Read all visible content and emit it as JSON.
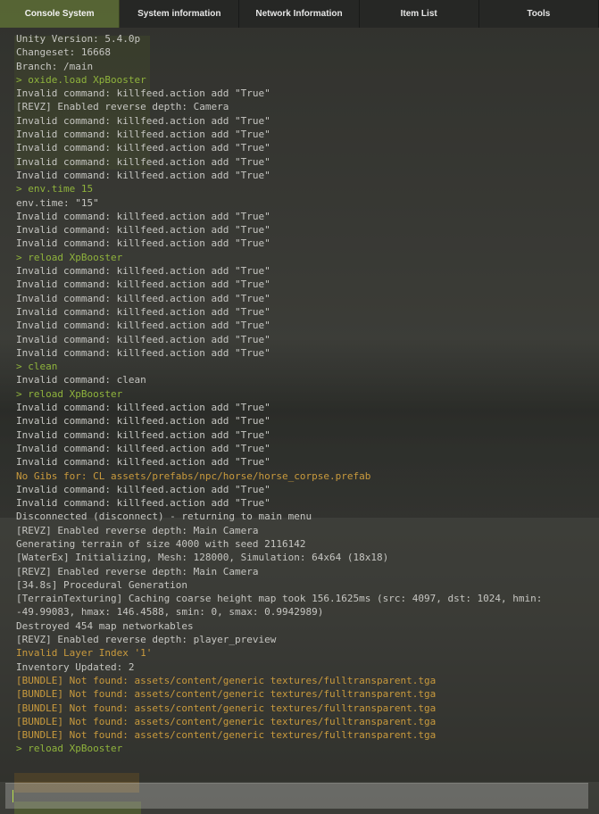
{
  "tabs": [
    {
      "label": "Console System",
      "active": true
    },
    {
      "label": "System information",
      "active": false
    },
    {
      "label": "Network Information",
      "active": false
    },
    {
      "label": "Item List",
      "active": false
    },
    {
      "label": "Tools",
      "active": false
    }
  ],
  "colors": {
    "default_text": "#c6c6c2",
    "command_text": "#8fb33c",
    "warning_text": "#c99a3d",
    "active_tab": "#697c3c"
  },
  "log": [
    {
      "text": "Unity Version: 5.4.0p",
      "type": "default"
    },
    {
      "text": "Changeset: 16668",
      "type": "default"
    },
    {
      "text": "Branch: /main",
      "type": "default"
    },
    {
      "text": "> oxide.load XpBooster",
      "type": "command"
    },
    {
      "text": "Invalid command: killfeed.action add \"True\"",
      "type": "default"
    },
    {
      "text": "[REVZ] Enabled reverse depth: Camera",
      "type": "default"
    },
    {
      "text": "Invalid command: killfeed.action add \"True\"",
      "type": "default"
    },
    {
      "text": "Invalid command: killfeed.action add \"True\"",
      "type": "default"
    },
    {
      "text": "Invalid command: killfeed.action add \"True\"",
      "type": "default"
    },
    {
      "text": "Invalid command: killfeed.action add \"True\"",
      "type": "default"
    },
    {
      "text": "Invalid command: killfeed.action add \"True\"",
      "type": "default"
    },
    {
      "text": "> env.time 15",
      "type": "command"
    },
    {
      "text": "env.time: \"15\"",
      "type": "default"
    },
    {
      "text": "Invalid command: killfeed.action add \"True\"",
      "type": "default"
    },
    {
      "text": "Invalid command: killfeed.action add \"True\"",
      "type": "default"
    },
    {
      "text": "Invalid command: killfeed.action add \"True\"",
      "type": "default"
    },
    {
      "text": "> reload XpBooster",
      "type": "command"
    },
    {
      "text": "Invalid command: killfeed.action add \"True\"",
      "type": "default"
    },
    {
      "text": "Invalid command: killfeed.action add \"True\"",
      "type": "default"
    },
    {
      "text": "Invalid command: killfeed.action add \"True\"",
      "type": "default"
    },
    {
      "text": "Invalid command: killfeed.action add \"True\"",
      "type": "default"
    },
    {
      "text": "Invalid command: killfeed.action add \"True\"",
      "type": "default"
    },
    {
      "text": "Invalid command: killfeed.action add \"True\"",
      "type": "default"
    },
    {
      "text": "Invalid command: killfeed.action add \"True\"",
      "type": "default"
    },
    {
      "text": "> clean",
      "type": "command"
    },
    {
      "text": "Invalid command: clean",
      "type": "default"
    },
    {
      "text": "> reload XpBooster",
      "type": "command"
    },
    {
      "text": "Invalid command: killfeed.action add \"True\"",
      "type": "default"
    },
    {
      "text": "Invalid command: killfeed.action add \"True\"",
      "type": "default"
    },
    {
      "text": "Invalid command: killfeed.action add \"True\"",
      "type": "default"
    },
    {
      "text": "Invalid command: killfeed.action add \"True\"",
      "type": "default"
    },
    {
      "text": "Invalid command: killfeed.action add \"True\"",
      "type": "default"
    },
    {
      "text": "No Gibs for: CL assets/prefabs/npc/horse/horse_corpse.prefab",
      "type": "warning"
    },
    {
      "text": "Invalid command: killfeed.action add \"True\"",
      "type": "default"
    },
    {
      "text": "Invalid command: killfeed.action add \"True\"",
      "type": "default"
    },
    {
      "text": "Disconnected (disconnect) - returning to main menu",
      "type": "default"
    },
    {
      "text": "[REVZ] Enabled reverse depth: Main Camera",
      "type": "default"
    },
    {
      "text": "Generating terrain of size 4000 with seed 2116142",
      "type": "default"
    },
    {
      "text": "[WaterEx] Initializing, Mesh: 128000, Simulation: 64x64 (18x18)",
      "type": "default"
    },
    {
      "text": "[REVZ] Enabled reverse depth: Main Camera",
      "type": "default"
    },
    {
      "text": "[34.8s] Procedural Generation",
      "type": "default"
    },
    {
      "text": "[TerrainTexturing] Caching coarse height map took 156.1625ms (src: 4097, dst: 1024, hmin:",
      "type": "default"
    },
    {
      "text": "-49.99083, hmax: 146.4588, smin: 0, smax: 0.9942989)",
      "type": "default"
    },
    {
      "text": "Destroyed 454 map networkables",
      "type": "default"
    },
    {
      "text": "[REVZ] Enabled reverse depth: player_preview",
      "type": "default"
    },
    {
      "text": "Invalid Layer Index '1'",
      "type": "warning"
    },
    {
      "text": "Inventory Updated: 2",
      "type": "default"
    },
    {
      "text": "[BUNDLE] Not found: assets/content/generic textures/fulltransparent.tga",
      "type": "warning"
    },
    {
      "text": "[BUNDLE] Not found: assets/content/generic textures/fulltransparent.tga",
      "type": "warning"
    },
    {
      "text": "[BUNDLE] Not found: assets/content/generic textures/fulltransparent.tga",
      "type": "warning"
    },
    {
      "text": "[BUNDLE] Not found: assets/content/generic textures/fulltransparent.tga",
      "type": "warning"
    },
    {
      "text": "[BUNDLE] Not found: assets/content/generic textures/fulltransparent.tga",
      "type": "warning"
    },
    {
      "text": "> reload XpBooster",
      "type": "command"
    }
  ],
  "input": {
    "value": "",
    "placeholder": ""
  }
}
